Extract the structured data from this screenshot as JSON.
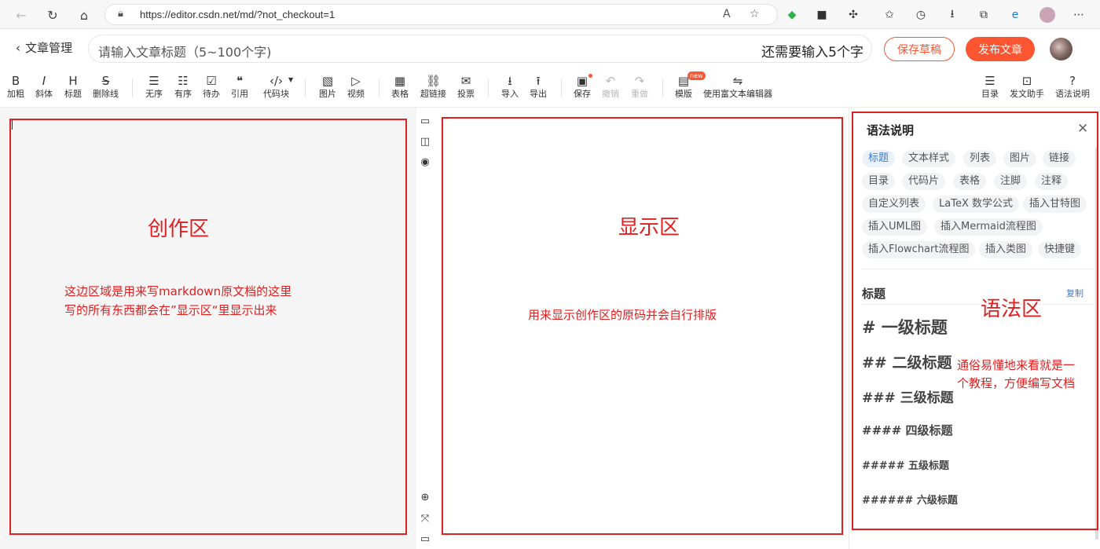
{
  "browser": {
    "url": "https://editor.csdn.net/md/?not_checkout=1"
  },
  "header": {
    "back_label": "文章管理",
    "title_placeholder": "请输入文章标题（5~100个字)",
    "title_counter": "还需要输入5个字",
    "save_draft_label": "保存草稿",
    "publish_label": "发布文章"
  },
  "toolbar": {
    "items": [
      {
        "icon": "B",
        "label": "加粗"
      },
      {
        "icon": "I",
        "label": "斜体"
      },
      {
        "icon": "H",
        "label": "标题"
      },
      {
        "icon": "S",
        "label": "删除线"
      },
      {
        "icon": "☰",
        "label": "无序"
      },
      {
        "icon": "☷",
        "label": "有序"
      },
      {
        "icon": "☑",
        "label": "待办"
      },
      {
        "icon": "❝",
        "label": "引用"
      },
      {
        "icon": "‹/›",
        "label": "代码块"
      },
      {
        "icon": "▧",
        "label": "图片"
      },
      {
        "icon": "▷",
        "label": "视频"
      },
      {
        "icon": "▦",
        "label": "表格"
      },
      {
        "icon": "⛓",
        "label": "超链接"
      },
      {
        "icon": "✉",
        "label": "投票"
      },
      {
        "icon": "⭳",
        "label": "导入"
      },
      {
        "icon": "⭱",
        "label": "导出"
      },
      {
        "icon": "▣",
        "label": "保存"
      },
      {
        "icon": "↶",
        "label": "撤销"
      },
      {
        "icon": "↷",
        "label": "重做"
      },
      {
        "icon": "▤",
        "label": "模版"
      },
      {
        "icon": "⇋",
        "label": "使用富文本编辑器"
      },
      {
        "icon": "☰",
        "label": "目录"
      },
      {
        "icon": "⊡",
        "label": "发文助手"
      },
      {
        "icon": "?",
        "label": "语法说明"
      }
    ],
    "new_badge": "new"
  },
  "annotations": {
    "editor_title": "创作区",
    "editor_text_line1": "这边区域是用来写markdown原文档的这里",
    "editor_text_line2": "写的所有东西都会在”显示区“里显示出来",
    "preview_title": "显示区",
    "preview_text": "用来显示创作区的原码并会自行排版",
    "syntax_title": "语法区",
    "syntax_text_line1": "通俗易懂地来看就是一",
    "syntax_text_line2": "个教程，方便编写文档"
  },
  "syntax_panel": {
    "title": "语法说明",
    "tags": [
      "标题",
      "文本样式",
      "列表",
      "图片",
      "链接",
      "目录",
      "代码片",
      "表格",
      "注脚",
      "注释",
      "自定义列表",
      "LaTeX 数学公式",
      "插入甘特图",
      "插入UML图",
      "插入Mermaid流程图",
      "插入Flowchart流程图",
      "插入类图",
      "快捷键"
    ],
    "section_label": "标题",
    "copy_label": "复制",
    "headings": [
      "# 一级标题",
      "## 二级标题",
      "### 三级标题",
      "#### 四级标题",
      "##### 五级标题",
      "###### 六级标题"
    ]
  }
}
